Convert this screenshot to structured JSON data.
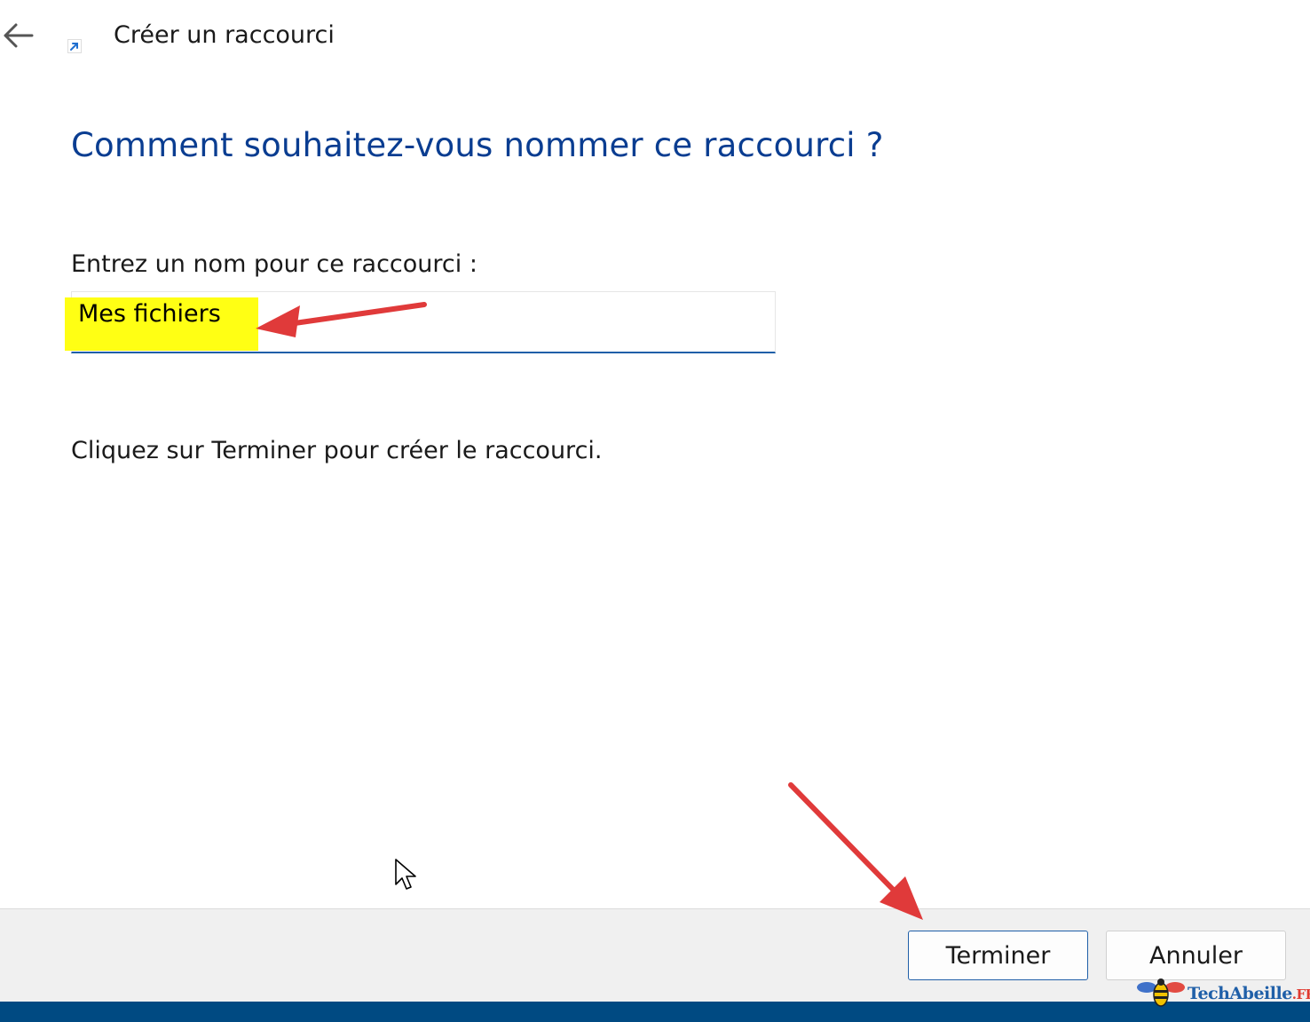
{
  "window": {
    "title": "Créer un raccourci"
  },
  "main": {
    "heading": "Comment souhaitez-vous nommer ce raccourci ?",
    "field_label": "Entrez un nom pour ce raccourci :",
    "name_input": {
      "value": "Mes fichiers"
    },
    "finish_hint": "Cliquez sur Terminer pour créer le raccourci."
  },
  "footer": {
    "finish_label": "Terminer",
    "cancel_label": "Annuler"
  },
  "watermark": {
    "brand": "TechAbeille",
    "suffix": ".FR"
  },
  "icons": {
    "back": "arrow-left-icon",
    "shortcut": "shortcut-overlay-icon",
    "cursor": "mouse-pointer-icon",
    "bee": "bee-logo-icon"
  },
  "colors": {
    "heading": "#0a3d91",
    "input_underline": "#1f5fa8",
    "highlight": "#ffff14",
    "annotation_arrow": "#e03a3a",
    "taskbar": "#004a82"
  }
}
